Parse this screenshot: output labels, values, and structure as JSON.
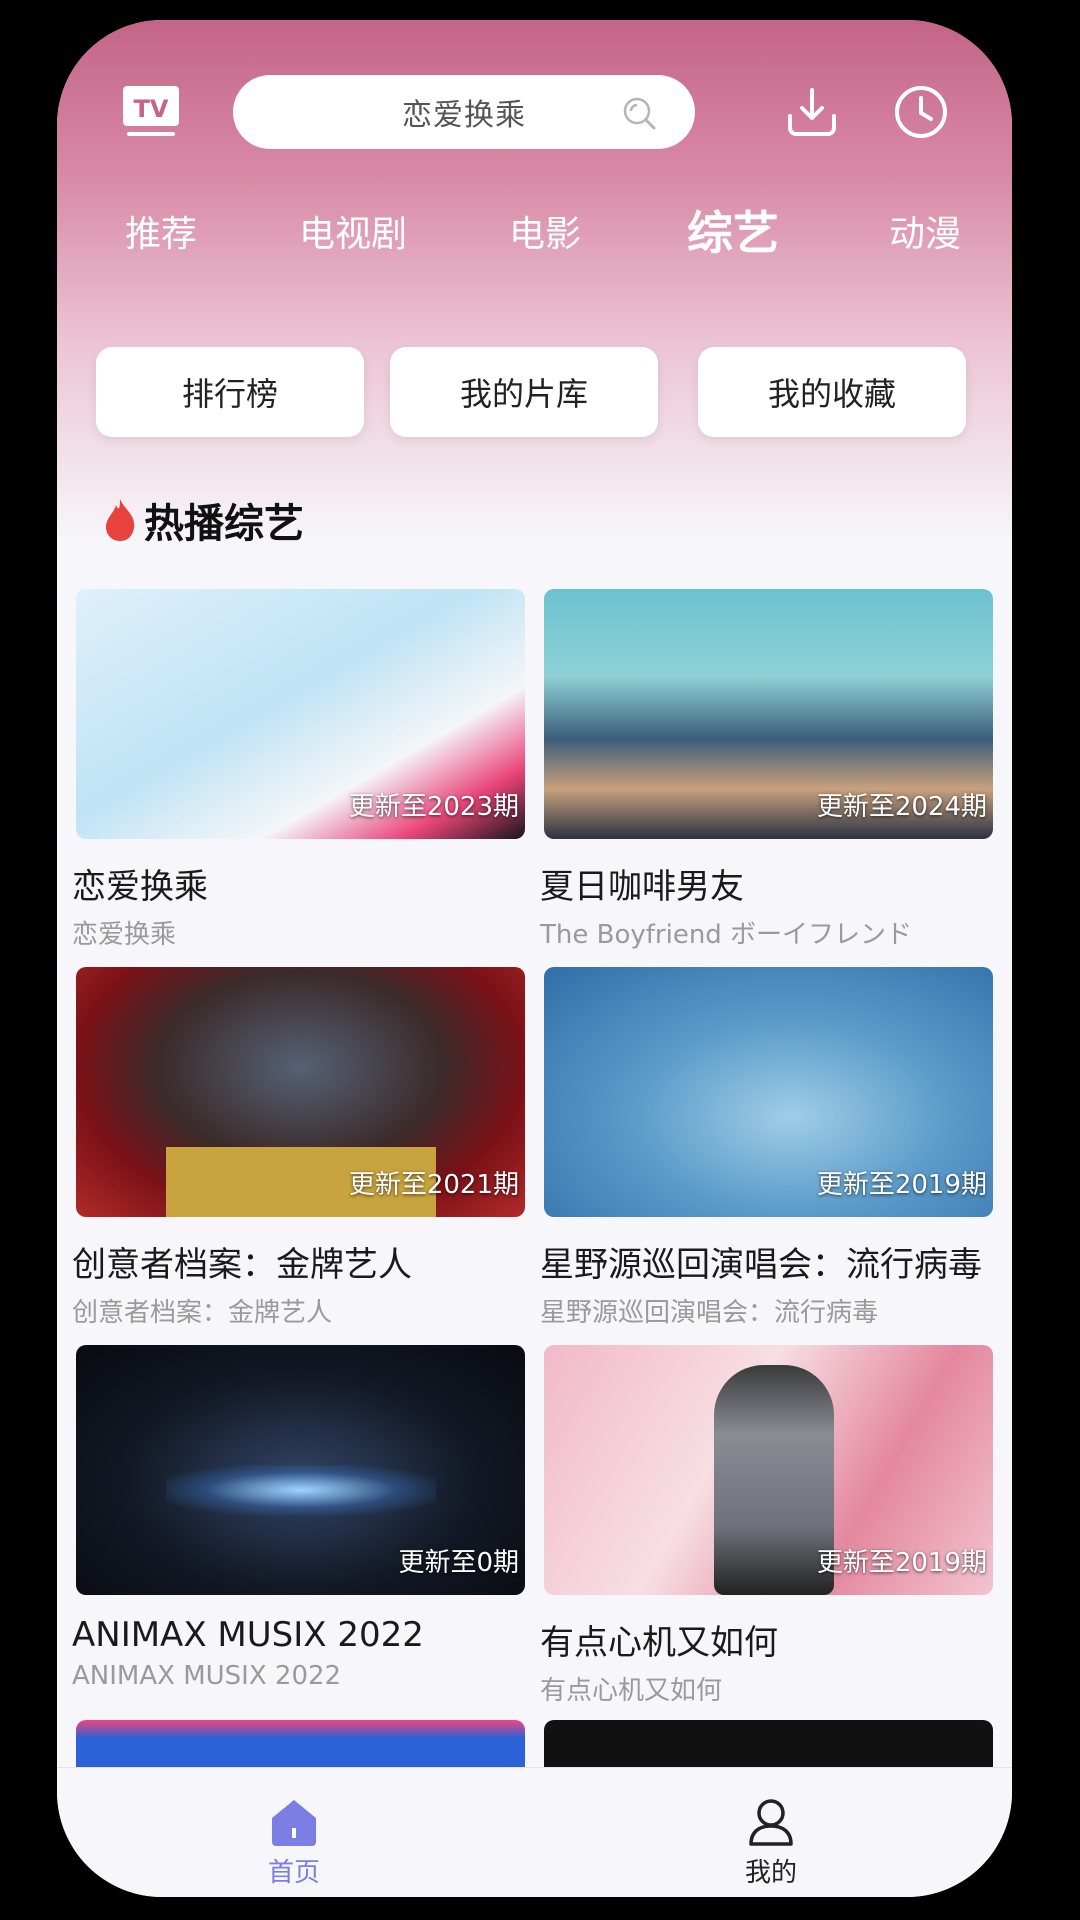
{
  "header": {
    "logo_text": "TV",
    "search_text": "恋爱换乘"
  },
  "tabs": [
    {
      "label": "推荐",
      "active": false
    },
    {
      "label": "电视剧",
      "active": false
    },
    {
      "label": "电影",
      "active": false
    },
    {
      "label": "综艺",
      "active": true
    },
    {
      "label": "动漫",
      "active": false
    }
  ],
  "quick_buttons": [
    "排行榜",
    "我的片库",
    "我的收藏"
  ],
  "section": {
    "title": "热播综艺"
  },
  "cards": [
    {
      "title": "恋爱换乘",
      "subtitle": "恋爱换乘",
      "badge": "更新至2023期"
    },
    {
      "title": "夏日咖啡男友",
      "subtitle": "The Boyfriend ボーイフレンド",
      "badge": "更新至2024期"
    },
    {
      "title": "创意者档案：金牌艺人",
      "subtitle": "创意者档案：金牌艺人",
      "badge": "更新至2021期"
    },
    {
      "title": "星野源巡回演唱会：流行病毒",
      "subtitle": "星野源巡回演唱会：流行病毒",
      "badge": "更新至2019期"
    },
    {
      "title": "ANIMAX MUSIX 2022",
      "subtitle": "ANIMAX MUSIX 2022",
      "badge": "更新至0期"
    },
    {
      "title": "有点心机又如何",
      "subtitle": "有点心机又如何",
      "badge": "更新至2019期"
    }
  ],
  "bottom_nav": [
    {
      "label": "首页",
      "active": true,
      "icon": "home-icon"
    },
    {
      "label": "我的",
      "active": false,
      "icon": "profile-icon"
    }
  ],
  "colors": {
    "accent": "#7b7ee3",
    "header_pink": "#c46487"
  }
}
